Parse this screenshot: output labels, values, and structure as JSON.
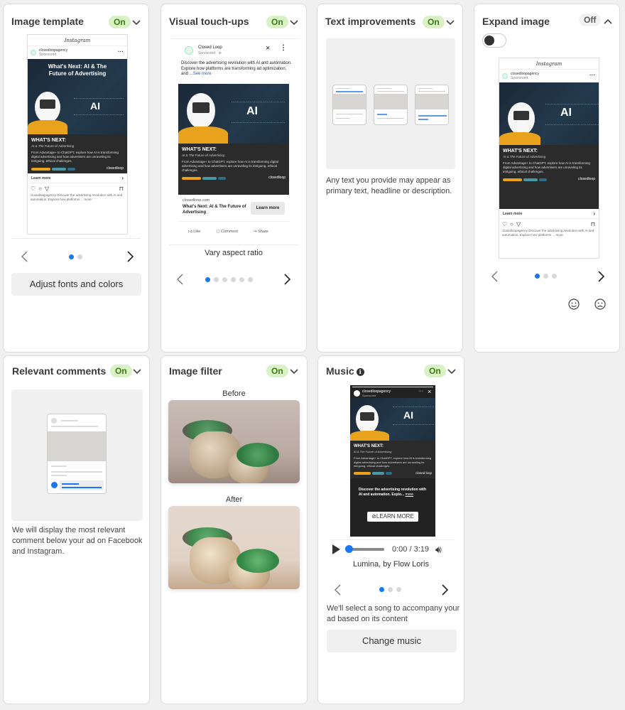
{
  "cards": {
    "image_template": {
      "title": "Image template",
      "status": "On",
      "ad": {
        "platform": "Instagram",
        "account": "closedloopagency",
        "sponsored": "Sponsored",
        "headline": "What's Next: AI & The Future of Advertising",
        "ai_text": "AI",
        "whats_next": "WHAT'S NEXT:",
        "subtitle": "AI & The Future of Advertising",
        "body": "From Advantage+ to ChatGPT, explore how AI is transforming digital advertising and how advertisers are unraveling its intriguing, ethical challenges.",
        "brand": "closedloop",
        "learn_more": "Learn more",
        "caption": "closedloopagency Discover the advertising revolution with AI and automation. Explore how platforms ... more"
      },
      "carousel": {
        "total": 2,
        "active": 0
      },
      "button": "Adjust fonts and colors"
    },
    "visual_touchups": {
      "title": "Visual touch-ups",
      "status": "On",
      "ad": {
        "page": "Closed Loop",
        "sponsored": "Sponsored · ⊕",
        "primary_text": "Discover the advertising revolution with AI and automation. Explore how platforms are transforming ad optimization, and",
        "see_more": "...See more",
        "ai_text": "AI",
        "whats_next": "WHAT'S NEXT:",
        "subtitle": "AI & The Future of Advertising",
        "body": "From Advantage+ to ChatGPT, explore how AI is transforming digital advertising and how advertisers are unraveling its intriguing, ethical challenges.",
        "brand": "closedloop",
        "domain": "closedloop.com",
        "link_title": "What's Next: AI & The Future of Advertising",
        "cta": "Learn more",
        "like": "Like",
        "comment": "Comment",
        "share": "Share"
      },
      "caption": "Vary aspect ratio",
      "carousel": {
        "total": 6,
        "active": 0
      }
    },
    "text_improvements": {
      "title": "Text improvements",
      "status": "On",
      "description": "Any text you provide may appear as primary text, headline or description."
    },
    "expand_image": {
      "title": "Expand image",
      "status": "Off",
      "toggle_on": false,
      "ad": {
        "platform": "Instagram",
        "account": "closedloopagency",
        "sponsored": "Sponsored",
        "ai_text": "AI",
        "whats_next": "WHAT'S NEXT:",
        "subtitle": "AI & The Future of Advertising",
        "body": "From Advantage+ to ChatGPT, explore how AI is transforming digital advertising and how advertisers are unraveling its intriguing, ethical challenges.",
        "brand": "closedloop",
        "learn_more": "Learn more",
        "caption": "closedloopagency Discover the advertising revolution with AI and automation. Explore how platforms ... more"
      },
      "carousel": {
        "total": 3,
        "active": 0
      }
    },
    "relevant_comments": {
      "title": "Relevant comments",
      "status": "On",
      "description": "We will display the most relevant comment below your ad on Facebook and Instagram."
    },
    "image_filter": {
      "title": "Image filter",
      "status": "On",
      "before_label": "Before",
      "after_label": "After"
    },
    "music": {
      "title": "Music",
      "status": "On",
      "story": {
        "account": "closedloopagency",
        "sponsored": "Sponsored",
        "ai_text": "AI",
        "whats_next": "WHAT'S NEXT:",
        "subtitle": "AI & The Future of Advertising",
        "body": "From Advantage+ to ChatGPT, explore how AI is transforming digital advertising and how advertisers are unraveling its intriguing, ethical challenges.",
        "brand": "closed loop",
        "caption": "Discover the advertising revolution with AI and automation. Explo...",
        "caption_more": "more",
        "cta": "LEARN MORE"
      },
      "player": {
        "time": "0:00 / 3:19",
        "progress": 0
      },
      "track": "Lumina, by Flow Loris",
      "carousel": {
        "total": 3,
        "active": 0
      },
      "description": "We'll select a song to accompany your ad based on its content",
      "button": "Change music"
    }
  },
  "colors": {
    "accent": "#1877f2",
    "on_badge_bg": "#d8f1c5",
    "on_badge_text": "#3f7a12"
  }
}
